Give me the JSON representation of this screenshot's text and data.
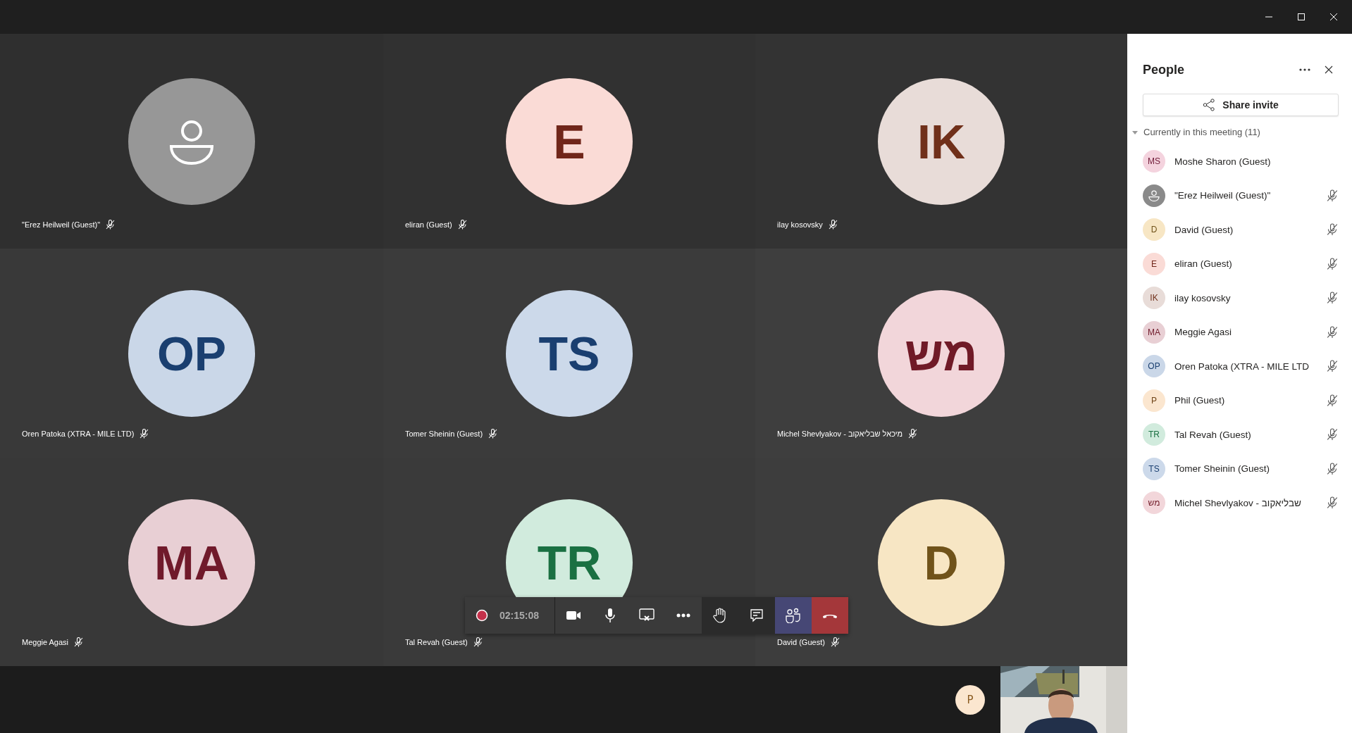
{
  "tiles": [
    {
      "name": "\"Erez Heilweil (Guest)\"",
      "kind": "icon",
      "color": "#979797",
      "muted": true
    },
    {
      "name": "eliran (Guest)",
      "initials": "E",
      "kind": "initials",
      "color": "#fadbd6",
      "muted": true
    },
    {
      "name": "ilay kosovsky",
      "initials": "IK",
      "kind": "initials",
      "color": "#e8dcd8",
      "muted": true
    },
    {
      "name": "Oren Patoka (XTRA - MILE LTD)",
      "initials": "OP",
      "kind": "initials",
      "color": "#cad7e8",
      "muted": true
    },
    {
      "name": "Tomer Sheinin (Guest)",
      "initials": "TS",
      "kind": "initials",
      "color": "#ccd9ea",
      "muted": true
    },
    {
      "name": "Michel Shevlyakov - מיכאל שבליאקוב",
      "initials": "מש",
      "kind": "initials",
      "color": "#f2d6da",
      "muted": true
    },
    {
      "name": "Meggie Agasi",
      "initials": "MA",
      "kind": "initials",
      "color": "#e8cfd4",
      "muted": true
    },
    {
      "name": "Tal Revah (Guest)",
      "initials": "TR",
      "kind": "initials",
      "color": "#d1ebdd",
      "muted": true
    },
    {
      "name": "David (Guest)",
      "initials": "D",
      "kind": "initials",
      "color": "#f7e6c4",
      "muted": true
    }
  ],
  "toolbar": {
    "recording": true,
    "time": "02:15:08",
    "buttons": [
      {
        "kind": "camera",
        "selected": false
      },
      {
        "kind": "mic",
        "selected": false
      },
      {
        "kind": "share",
        "selected": false
      },
      {
        "kind": "more",
        "selected": false
      },
      {
        "kind": "hand",
        "selected": false
      },
      {
        "kind": "chat",
        "selected": false
      },
      {
        "kind": "people",
        "selected": true
      },
      {
        "kind": "hangup",
        "selected": false
      }
    ]
  },
  "self_view": {
    "initials": "P",
    "kind": "picture"
  },
  "panel": {
    "title": "People",
    "share_button": "Share invite",
    "section": {
      "label": "Currently in this meeting (11)",
      "expanded": true
    },
    "people": [
      {
        "name": "Moshe Sharon (Guest)",
        "initials": "MS",
        "kind": "initials",
        "color": "#f4d3de",
        "muted": false
      },
      {
        "name": "\"Erez Heilweil (Guest)\"",
        "kind": "icon",
        "color": "#8a8a8a",
        "muted": true
      },
      {
        "name": "David (Guest)",
        "initials": "D",
        "kind": "initials",
        "color": "#f7e6c4",
        "muted": true
      },
      {
        "name": "eliran (Guest)",
        "initials": "E",
        "kind": "initials",
        "color": "#fadbd6",
        "muted": true
      },
      {
        "name": "ilay kosovsky",
        "initials": "IK",
        "kind": "initials",
        "color": "#e8dcd8",
        "muted": true
      },
      {
        "name": "Meggie Agasi",
        "initials": "MA",
        "kind": "initials",
        "color": "#e8cfd4",
        "muted": true
      },
      {
        "name": "Oren Patoka (XTRA - MILE LTD",
        "initials": "OP",
        "kind": "initials",
        "color": "#cad7e8",
        "muted": true
      },
      {
        "name": "Phil (Guest)",
        "initials": "P",
        "kind": "initials",
        "color": "#fbe6cf",
        "muted": true
      },
      {
        "name": "Tal Revah (Guest)",
        "initials": "TR",
        "kind": "initials",
        "color": "#d1ebdd",
        "muted": true
      },
      {
        "name": "Tomer Sheinin (Guest)",
        "initials": "TS",
        "kind": "initials",
        "color": "#ccd9ea",
        "muted": true
      },
      {
        "name": "Michel Shevlyakov - שבליאקוב",
        "initials": "מש",
        "kind": "initials",
        "color": "#f2d6da",
        "muted": true
      }
    ]
  }
}
